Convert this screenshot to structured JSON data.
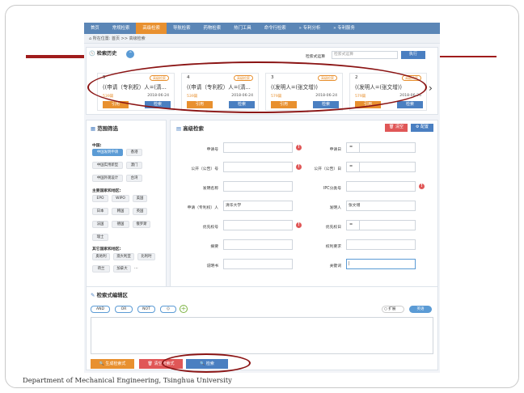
{
  "nav": [
    "首页",
    "常规检索",
    "高级检索",
    "导航检索",
    "药物检索",
    "热门工具",
    "命令行检索",
    "专利分析",
    "专利服务"
  ],
  "nav_active_index": 2,
  "breadcrumb": "所在位置: 首页 >> 高级检索",
  "history": {
    "title": "检索历史",
    "filter_label": "检索式运算",
    "filter_placeholder": "检索式运算",
    "run_button": "执行",
    "cards": [
      {
        "num": "5",
        "tag": "高级检索",
        "expr": "((申请（专利权）人=(清...",
        "count": "539篇",
        "date": "2018-06-24",
        "cite": "引用",
        "search": "检索"
      },
      {
        "num": "4",
        "tag": "高级检索",
        "expr": "((申请（专利权）人=(清...",
        "count": "539篇",
        "date": "2018-06-24",
        "cite": "引用",
        "search": "检索"
      },
      {
        "num": "3",
        "tag": "高级检索",
        "expr": "((发明人=(张文增))",
        "count": "579篇",
        "date": "2018-06-24",
        "cite": "引用",
        "search": "检索"
      },
      {
        "num": "2",
        "tag": "高级检索",
        "expr": "((发明人=(张文增))",
        "count": "579篇",
        "date": "2018-06-24",
        "cite": "引用",
        "search": "检索"
      }
    ],
    "next_arrow": "›"
  },
  "scope": {
    "title": "范围筛选",
    "china_label": "中国:",
    "china_chips": [
      "中国发明申请",
      "香港",
      "中国实用新型",
      "澳门",
      "中国外观设计",
      "台湾"
    ],
    "major_label": "主要国家和地区:",
    "major_chips": [
      "EPO",
      "WIPO",
      "美国",
      "日本",
      "韩国",
      "英国",
      "法国",
      "德国",
      "俄罗斯",
      "瑞士"
    ],
    "other_label": "其它国家和地区:",
    "other_chips": [
      "奥地利",
      "澳大利亚",
      "比利时",
      "荷兰",
      "加拿大"
    ],
    "more": "..."
  },
  "advanced": {
    "title": "高级检索",
    "clear_button": "清空",
    "config_button": "配置",
    "fields": {
      "app_no": "申请号",
      "app_date": "申请日",
      "pub_no": "公开（公告）号",
      "pub_date": "公开（公告）日",
      "invention_name": "发明名称",
      "ipc": "IPC分类号",
      "applicant": "申请（专利权）人",
      "applicant_value": "清华大学",
      "inventor": "发明人",
      "inventor_value": "张文增",
      "priority_no": "优先权号",
      "priority_date": "优先权日",
      "abstract": "摘要",
      "claims": "权利要求",
      "description": "说明书",
      "keywords": "关键词"
    },
    "eq": "="
  },
  "editor": {
    "title": "检索式编辑区",
    "ops": [
      "AND",
      "OR",
      "NOT",
      "()"
    ],
    "add": "+",
    "expand": "扩展",
    "lang": "英语",
    "gen_button": "生成检索式",
    "clear_button": "清空检索式",
    "search_button": "检索"
  },
  "footer": "Department of Mechanical Engineering, Tsinghua University",
  "colors": {
    "nav": "#5b86b6",
    "accent": "#e8902f",
    "primary": "#4a7fc1",
    "danger": "#e05757",
    "annotation": "#8b1414"
  }
}
